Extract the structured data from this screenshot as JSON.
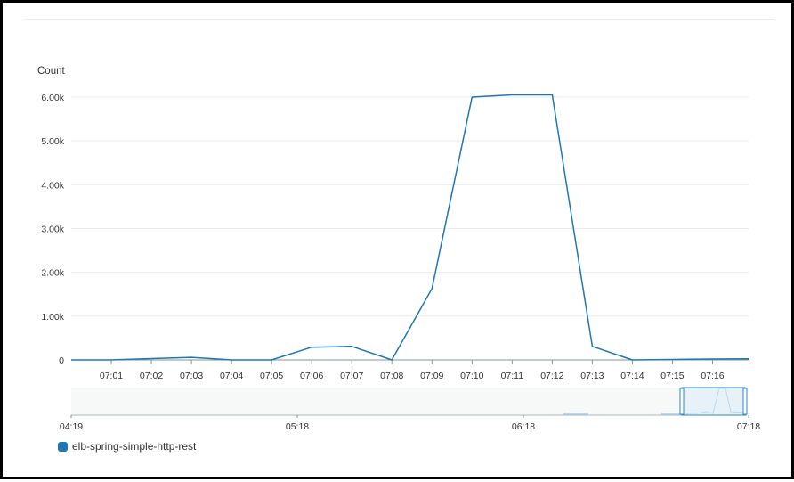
{
  "chart_data": {
    "type": "line",
    "ylabel": "Count",
    "ylim": [
      0,
      6000
    ],
    "y_ticks": [
      {
        "value": 0,
        "label": "0"
      },
      {
        "value": 1000,
        "label": "1.00k"
      },
      {
        "value": 2000,
        "label": "2.00k"
      },
      {
        "value": 3000,
        "label": "3.00k"
      },
      {
        "value": 4000,
        "label": "4.00k"
      },
      {
        "value": 5000,
        "label": "5.00k"
      },
      {
        "value": 6000,
        "label": "6.00k"
      }
    ],
    "x_range_minutes": [
      0,
      16.9
    ],
    "x_ticks": [
      {
        "minute": 1,
        "label": "07:01"
      },
      {
        "minute": 2,
        "label": "07:02"
      },
      {
        "minute": 3,
        "label": "07:03"
      },
      {
        "minute": 4,
        "label": "07:04"
      },
      {
        "minute": 5,
        "label": "07:05"
      },
      {
        "minute": 6,
        "label": "07:06"
      },
      {
        "minute": 7,
        "label": "07:07"
      },
      {
        "minute": 8,
        "label": "07:08"
      },
      {
        "minute": 9,
        "label": "07:09"
      },
      {
        "minute": 10,
        "label": "07:10"
      },
      {
        "minute": 11,
        "label": "07:11"
      },
      {
        "minute": 12,
        "label": "07:12"
      },
      {
        "minute": 13,
        "label": "07:13"
      },
      {
        "minute": 14,
        "label": "07:14"
      },
      {
        "minute": 15,
        "label": "07:15"
      },
      {
        "minute": 16,
        "label": "07:16"
      }
    ],
    "series": [
      {
        "name": "elb-spring-simple-http-rest",
        "color": "#1f77b4",
        "points": [
          {
            "minute": 0,
            "value": 0
          },
          {
            "minute": 1,
            "value": 0
          },
          {
            "minute": 2,
            "value": 30
          },
          {
            "minute": 3,
            "value": 60
          },
          {
            "minute": 4,
            "value": 0
          },
          {
            "minute": 5,
            "value": 0
          },
          {
            "minute": 6,
            "value": 290
          },
          {
            "minute": 7,
            "value": 310
          },
          {
            "minute": 8,
            "value": 0
          },
          {
            "minute": 9,
            "value": 1630
          },
          {
            "minute": 10,
            "value": 6000
          },
          {
            "minute": 11,
            "value": 6050
          },
          {
            "minute": 12,
            "value": 6050
          },
          {
            "minute": 13,
            "value": 310
          },
          {
            "minute": 14,
            "value": 0
          },
          {
            "minute": 15,
            "value": 10
          },
          {
            "minute": 16,
            "value": 20
          },
          {
            "minute": 16.9,
            "value": 25
          }
        ]
      }
    ],
    "navigator": {
      "ticks": [
        "04:19",
        "05:18",
        "06:18",
        "07:18"
      ],
      "selection": "07:00–07:17"
    },
    "legend_position": "bottom-left",
    "grid": true
  }
}
